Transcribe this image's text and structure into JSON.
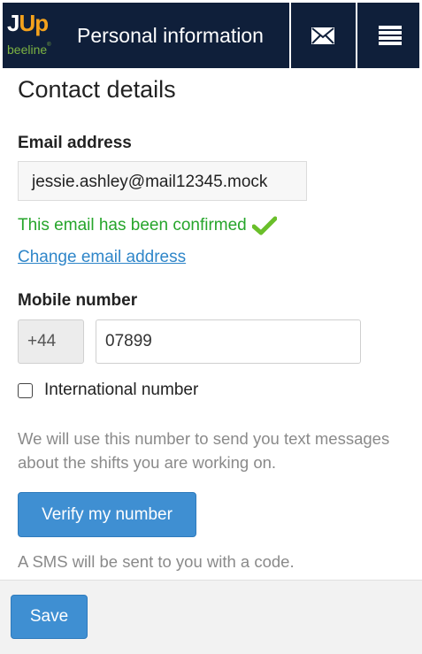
{
  "header": {
    "logo_j": "J",
    "logo_up": "Up",
    "logo_sub": "beeline",
    "title": "Personal information",
    "mail_icon": "envelope-icon",
    "menu_icon": "hamburger-menu-icon"
  },
  "contact": {
    "section_title": "Contact details",
    "email_label": "Email address",
    "email_value": "jessie.ashley@mail12345.mock",
    "confirmed_text": "This email has been confirmed",
    "confirmed_icon": "checkmark-icon",
    "change_email_link": "Change email address",
    "mobile_label": "Mobile number",
    "country_code": "+44",
    "mobile_value": "07899",
    "international_label": "International number",
    "international_checked": false,
    "help_text": "We will use this number to send you text messages about the shifts you are working on.",
    "verify_button": "Verify my number",
    "sms_note": "A SMS will be sent to you with a code."
  },
  "footer": {
    "save_button": "Save"
  },
  "colors": {
    "header_bg": "#0f1f3a",
    "logo_orange": "#f4a21c",
    "logo_green": "#7cb342",
    "confirm_green": "#26a52b",
    "link_blue": "#2f86c9",
    "button_blue": "#3f8fd2"
  }
}
